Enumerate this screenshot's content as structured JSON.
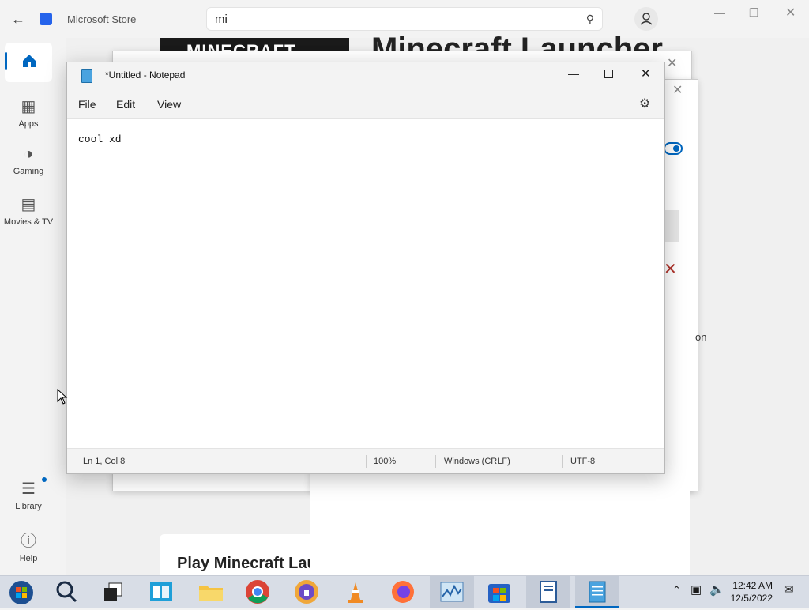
{
  "store": {
    "title": "Microsoft Store",
    "search_value": "mi",
    "nav": [
      {
        "label": "Apps"
      },
      {
        "label": "Gaming"
      },
      {
        "label": "Movies & TV"
      },
      {
        "label": "Library"
      },
      {
        "label": "Help"
      }
    ],
    "app_title": "Minecraft Launcher",
    "banner_text": "MINECRAFT",
    "play_text": "Play Minecraft Launcher",
    "fragment_on": "on"
  },
  "notepad": {
    "title": "*Untitled - Notepad",
    "menu": {
      "file": "File",
      "edit": "Edit",
      "view": "View"
    },
    "content": "cool xd",
    "status": {
      "position": "Ln 1, Col 8",
      "zoom": "100%",
      "line_ending": "Windows (CRLF)",
      "encoding": "UTF-8"
    }
  },
  "taskbar": {
    "time": "12:42 AM",
    "date": "12/5/2022"
  },
  "colors": {
    "accent": "#0067c0",
    "toggle": "#0067c0",
    "close_red": "#c42b1c"
  }
}
